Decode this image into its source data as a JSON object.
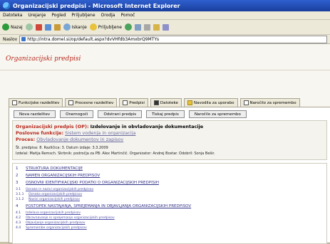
{
  "window": {
    "title": "Organizacijski predpisi - Microsoft Internet Explorer"
  },
  "menu": [
    "Datoteka",
    "Urejanje",
    "Pogled",
    "Priljubljene",
    "Orodja",
    "Pomoč"
  ],
  "toolbar": {
    "back": "Nazaj",
    "search": "Iskanje",
    "favorites": "Priljubljene"
  },
  "address": {
    "label": "Naslov",
    "url": "http://intra.domel.si/op/default.aspx?dvVHfdb3AmxbrQ9MTYs"
  },
  "app": {
    "title": "Organizacijski predpisi"
  },
  "tabs": [
    "Funkcijske razdelitev",
    "Procesne razdelitev",
    "Predpisi",
    "Datoteke",
    "Navodila za uporabo",
    "Naročilo za spremembo"
  ],
  "buttons": [
    "Nova razdelitev",
    "Onemogoči",
    "Odstrani predpis",
    "Tiskaj predpis",
    "Naročilo za spremembo"
  ],
  "doc": {
    "op_label": "Organizacijski predpis (OP):",
    "op_value": "Izdelovanje in obvladovanje dokumentacije",
    "func_label": "Poslovne funkcije:",
    "func_value": "Sistem vodenja in organizacija",
    "proc_label": "Proces:",
    "proc_value": "Obvladovanje dokumentov in zapisov",
    "meta1": "Št. predpisa: 8. Različica: 3. Datum izdaje: 3.3.2009",
    "meta2": "Izdelal: Matija Remsch. Skrbnik: področja za PB: Alex Martinčič. Organizator: Andrej Bostar. Odobril: Sonja Bešir."
  },
  "toc": [
    {
      "num": "1",
      "label": "STRUKTURA DOKUMENTACIJE"
    },
    {
      "num": "2",
      "label": "NAMEN ORGANIZACIJSKIH PREDPISOV"
    },
    {
      "num": "3",
      "label": "OSNOVNI IDENTIFIKACIJSKI PODATKI O ORGANIZACIJSKIH PREDPISIH"
    },
    {
      "num": "3.1",
      "label": "Oznake in nazivi organizacijskih predpisov"
    },
    {
      "num": "3.1.1",
      "label": "Oznaka organizacijskih predpisov"
    },
    {
      "num": "3.1.2",
      "label": "Nazivi organizacijskih predpisov"
    },
    {
      "num": "4",
      "label": "POSTOPEK NASTAJANJA, SPREJEMANJA IN OBJAVLJANJA ORGANIZACIJSKIH PREDPISOV"
    },
    {
      "num": "4.1",
      "label": "Izdelava organizacijskih predpisov"
    },
    {
      "num": "4.2",
      "label": "Obravnavanje in sprejemanje organizacijskih predpisov"
    },
    {
      "num": "4.3",
      "label": "Objavljanje organizacijskih predpisov"
    },
    {
      "num": "4.4",
      "label": "Spremembe organizacijskih predpisov"
    }
  ]
}
